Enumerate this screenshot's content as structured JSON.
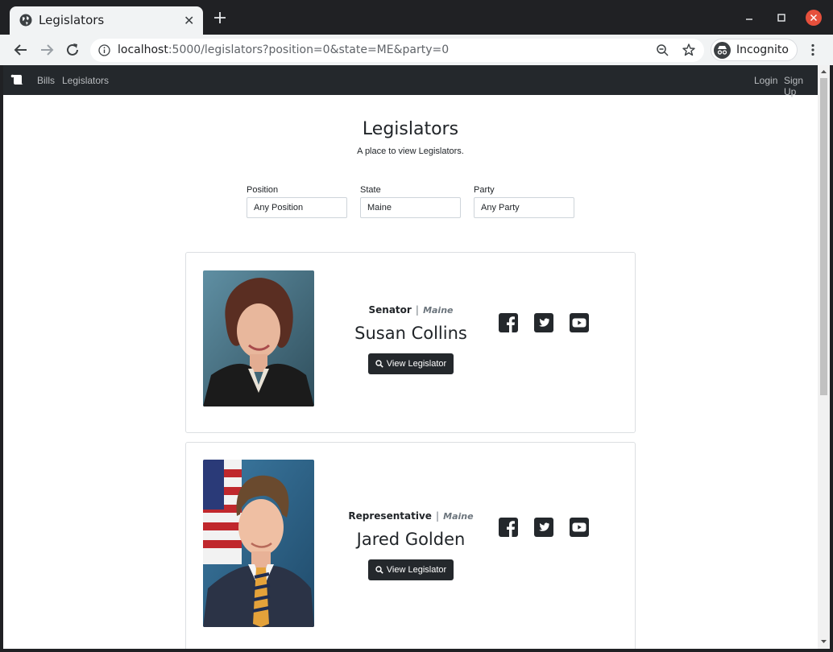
{
  "browser": {
    "tab_title": "Legislators",
    "url_host": "localhost",
    "url_rest": ":5000/legislators?position=0&state=ME&party=0",
    "incognito_label": "Incognito"
  },
  "nav": {
    "links": [
      "Bills",
      "Legislators"
    ],
    "auth_links": [
      "Login",
      "Sign Up"
    ]
  },
  "header": {
    "title": "Legislators",
    "subtitle": "A place to view Legislators."
  },
  "filters": [
    {
      "label": "Position",
      "value": "Any Position"
    },
    {
      "label": "State",
      "value": "Maine"
    },
    {
      "label": "Party",
      "value": "Any Party"
    }
  ],
  "legislators": [
    {
      "position": "Senator",
      "separator": "|",
      "state": "Maine",
      "name": "Susan Collins",
      "button": "View Legislator"
    },
    {
      "position": "Representative",
      "separator": "|",
      "state": "Maine",
      "name": "Jared Golden",
      "button": "View Legislator"
    }
  ],
  "icons": {
    "brand": "scroll-icon",
    "facebook": "facebook-icon",
    "twitter": "twitter-icon",
    "youtube": "youtube-icon",
    "search": "search-icon"
  },
  "colors": {
    "navbar": "#24282c",
    "button": "#24282c",
    "close_button": "#e6503c"
  }
}
